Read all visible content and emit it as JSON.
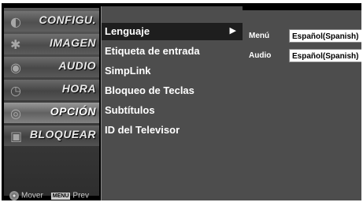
{
  "categories": [
    {
      "label": "CONFIGU.",
      "icon": "satellite-dish-icon"
    },
    {
      "label": "IMAGEN",
      "icon": "film-reel-icon"
    },
    {
      "label": "AUDIO",
      "icon": "speaker-icon"
    },
    {
      "label": "HORA",
      "icon": "clock-icon"
    },
    {
      "label": "OPCIÓN",
      "icon": "option-dial-icon"
    },
    {
      "label": "BLOQUEAR",
      "icon": "lock-icon"
    }
  ],
  "active_category": "OPCIÓN",
  "submenu": {
    "items": [
      "Lenguaje",
      "Etiqueta de entrada",
      "SimpLink",
      "Bloqueo de Teclas",
      "Subtítulos",
      "ID del Televisor"
    ],
    "selected_arrow": "▶"
  },
  "options": {
    "menu_label": "Menú",
    "menu_value": "Español(Spanish)",
    "audio_label": "Audio",
    "audio_value": "Español(Spanish)"
  },
  "nav_help": {
    "move_label": "Mover",
    "menu_key": "MENU",
    "prev_label": "Prev"
  }
}
